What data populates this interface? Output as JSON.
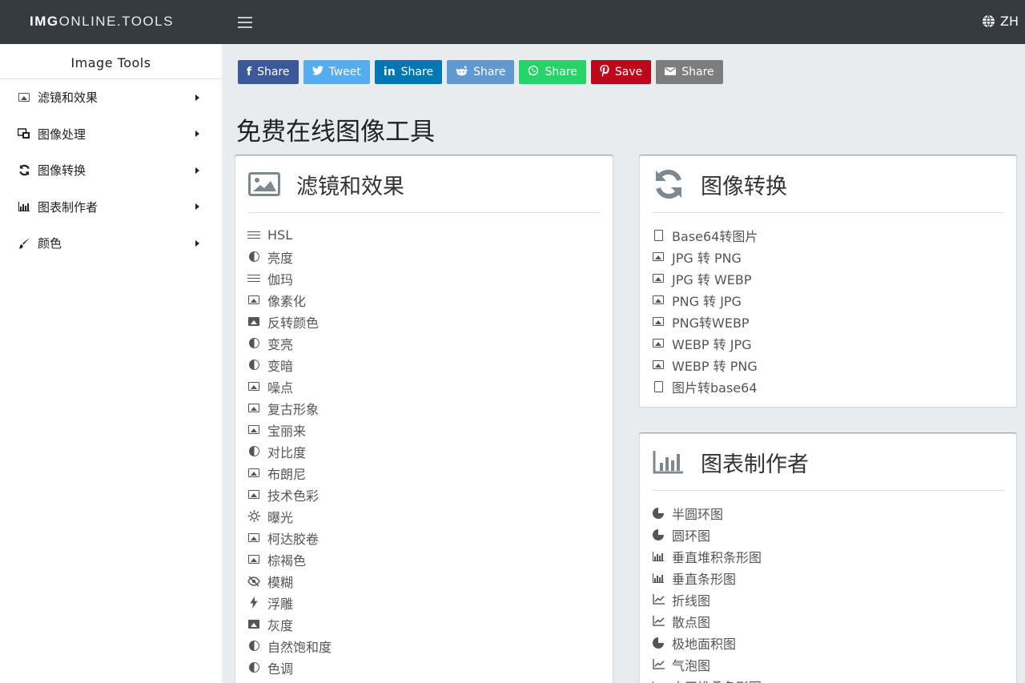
{
  "topbar": {
    "brand_bold": "IMG",
    "brand_rest": "ONLINE.TOOLS",
    "lang": "ZH"
  },
  "sidebar": {
    "title": "Image Tools",
    "items": [
      {
        "label": "滤镜和效果",
        "icon": "image-icon"
      },
      {
        "label": "图像处理",
        "icon": "image-edit-icon"
      },
      {
        "label": "图像转换",
        "icon": "sync-icon"
      },
      {
        "label": "图表制作者",
        "icon": "bar-chart-icon"
      },
      {
        "label": "颜色",
        "icon": "brush-icon"
      }
    ]
  },
  "shares": [
    {
      "label": "Share",
      "glyph": "f",
      "color": "#3b5998",
      "icon": "facebook-icon"
    },
    {
      "label": "Tweet",
      "glyph": "🐦",
      "color": "#55acee",
      "icon": "twitter-icon"
    },
    {
      "label": "Share",
      "glyph": "in",
      "color": "#0077b5",
      "icon": "linkedin-icon"
    },
    {
      "label": "Share",
      "glyph": "●",
      "color": "#5f99cf",
      "icon": "reddit-icon"
    },
    {
      "label": "Share",
      "glyph": "✆",
      "color": "#25d366",
      "icon": "whatsapp-icon"
    },
    {
      "label": "Save",
      "glyph": "P",
      "color": "#bd081c",
      "icon": "pinterest-icon"
    },
    {
      "label": "Share",
      "glyph": "✉",
      "color": "#7d7d7d",
      "icon": "email-icon"
    }
  ],
  "page_title": "免费在线图像工具",
  "filters_card": {
    "title": "滤镜和效果",
    "items": [
      {
        "label": "HSL",
        "icon": "sliders-icon"
      },
      {
        "label": "亮度",
        "icon": "contrast-icon"
      },
      {
        "label": "伽玛",
        "icon": "sliders-icon"
      },
      {
        "label": "像素化",
        "icon": "image-icon"
      },
      {
        "label": "反转颜色",
        "icon": "image-filled-icon"
      },
      {
        "label": "变亮",
        "icon": "contrast-icon"
      },
      {
        "label": "变暗",
        "icon": "contrast-icon"
      },
      {
        "label": "噪点",
        "icon": "image-icon"
      },
      {
        "label": "复古形象",
        "icon": "image-icon"
      },
      {
        "label": "宝丽来",
        "icon": "image-icon"
      },
      {
        "label": "对比度",
        "icon": "contrast-icon"
      },
      {
        "label": "布朗尼",
        "icon": "image-icon"
      },
      {
        "label": "技术色彩",
        "icon": "image-icon"
      },
      {
        "label": "曝光",
        "icon": "sun-icon"
      },
      {
        "label": "柯达胶卷",
        "icon": "image-icon"
      },
      {
        "label": "棕褐色",
        "icon": "image-icon"
      },
      {
        "label": "模糊",
        "icon": "eye-slash-icon"
      },
      {
        "label": "浮雕",
        "icon": "bolt-icon"
      },
      {
        "label": "灰度",
        "icon": "image-filled-icon"
      },
      {
        "label": "自然饱和度",
        "icon": "contrast-icon"
      },
      {
        "label": "色调",
        "icon": "contrast-icon"
      }
    ]
  },
  "convert_card": {
    "title": "图像转换",
    "items": [
      {
        "label": "Base64转图片",
        "icon": "file-code-icon"
      },
      {
        "label": "JPG 转 PNG",
        "icon": "image-icon"
      },
      {
        "label": "JPG 转 WEBP",
        "icon": "image-icon"
      },
      {
        "label": "PNG 转 JPG",
        "icon": "image-icon"
      },
      {
        "label": "PNG转WEBP",
        "icon": "image-icon"
      },
      {
        "label": "WEBP 转 JPG",
        "icon": "image-icon"
      },
      {
        "label": "WEBP 转 PNG",
        "icon": "image-icon"
      },
      {
        "label": "图片转base64",
        "icon": "file-code-icon"
      }
    ]
  },
  "chart_card": {
    "title": "图表制作者",
    "items": [
      {
        "label": "半圆环图",
        "icon": "pie-icon"
      },
      {
        "label": "圆环图",
        "icon": "pie-icon"
      },
      {
        "label": "垂直堆积条形图",
        "icon": "bar-chart-icon"
      },
      {
        "label": "垂直条形图",
        "icon": "bar-chart-icon"
      },
      {
        "label": "折线图",
        "icon": "line-chart-icon"
      },
      {
        "label": "散点图",
        "icon": "line-chart-icon"
      },
      {
        "label": "极地面积图",
        "icon": "pie-icon"
      },
      {
        "label": "气泡图",
        "icon": "line-chart-icon"
      },
      {
        "label": "水平堆叠条形图",
        "icon": "bar-chart-icon"
      }
    ]
  }
}
